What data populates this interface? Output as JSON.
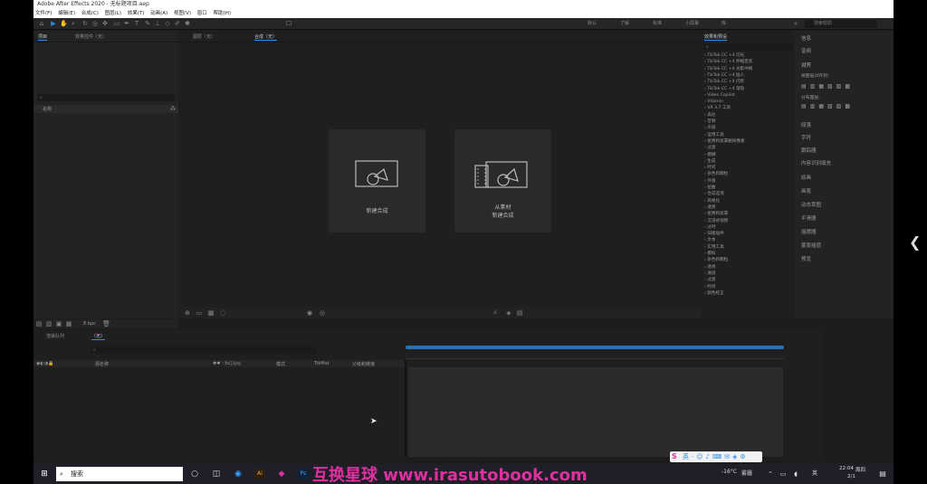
{
  "window": {
    "title": "Adobe After Effects 2020 - 无标题项目.aep"
  },
  "menu": [
    "文件(F)",
    "编辑(E)",
    "合成(C)",
    "图层(L)",
    "效果(T)",
    "动画(A)",
    "视图(V)",
    "窗口",
    "帮助(H)"
  ],
  "toolbar": {
    "workspaces": [
      "默认",
      "了解",
      "标准",
      "小屏幕",
      "库"
    ],
    "search_placeholder": "搜索帮助"
  },
  "project_panel": {
    "tabs": [
      "项目",
      "效果控件（无）"
    ],
    "search_placeholder": "",
    "column_name": "名称",
    "bit_depth": "8 bpc"
  },
  "composition_panel": {
    "tabs": [
      "图层（无）",
      "合成（无）"
    ],
    "new_comp_label": "新建合成",
    "from_footage_label_1": "从素材",
    "from_footage_label_2": "新建合成"
  },
  "effects_panel": {
    "title": "效果和预设",
    "items": [
      "TikTok CC +4 切光",
      "TikTok CC +4 伸缩变焦",
      "TikTok CC +4 光影冲刷",
      "TikTok CC +4 插入",
      "TikTok CC +4 闪烁",
      "TikTok CC +4 渐隐",
      "Video Copilot",
      "Vitamin",
      "VR 3.7 工具",
      "表达",
      "音频",
      "声道",
      "运用工具",
      "抠像和遮罩删除像素",
      "过渡",
      "模糊",
      "生成",
      "时间",
      "杂色和颗粒",
      "外观",
      "扭曲",
      "合成选项",
      "风格化",
      "透视",
      "抠像和遮罩",
      "沉浸式视频",
      "过时",
      "旧版插件",
      "文本",
      "实用工具",
      "模拟",
      "杂色和颗粒",
      "透视",
      "通道",
      "过渡",
      "时间",
      "颜色校正"
    ]
  },
  "right_panel": {
    "items": [
      "信息",
      "音频",
      "对齐",
      "段落",
      "字符",
      "跟踪器",
      "内容识别填充",
      "绘画",
      "画笔",
      "动态草图",
      "平滑器",
      "摇摆器",
      "蒙版插值",
      "预览"
    ],
    "align_label": "将图层对齐到：",
    "distribute_label": "分布图层："
  },
  "timeline_panel": {
    "tabs": [
      "渲染队列",
      "（无）"
    ],
    "columns": [
      "源名称",
      "模式",
      "TrkMat",
      "父级和链接"
    ],
    "search_placeholder": ""
  },
  "taskbar": {
    "search_label": "搜索",
    "weather": "-16°C",
    "weather_desc": "雾霾",
    "time": "22:04",
    "day": "周四",
    "date": "2/1",
    "language": "英"
  },
  "watermark": "互换星球 www.irasutobook.com",
  "colors": {
    "accent": "#2d8ceb",
    "background": "#1d1d1d",
    "panel": "#232323",
    "watermark": "#e0309e"
  }
}
